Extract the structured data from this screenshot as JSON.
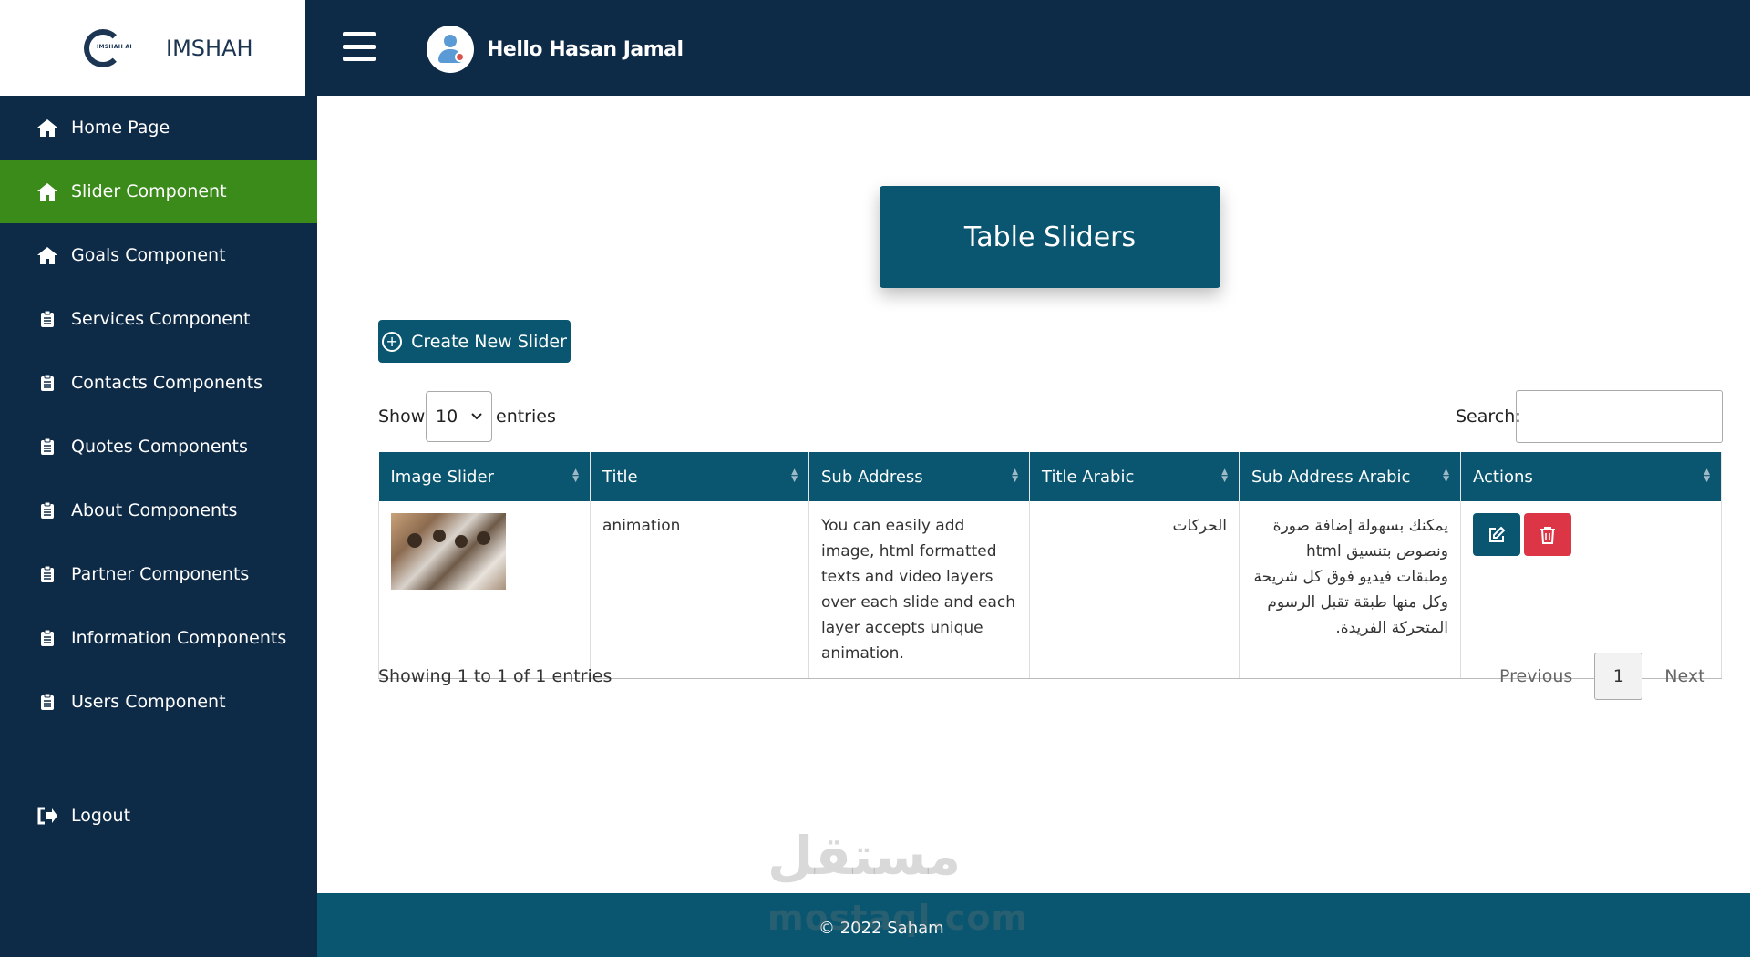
{
  "header": {
    "brand_name": "IMSHAH",
    "brand_logo_text": "IMSHAH AI",
    "greeting": "Hello Hasan Jamal"
  },
  "sidebar": {
    "items": [
      {
        "label": "Home Page",
        "icon": "home-icon",
        "active": false
      },
      {
        "label": "Slider Component",
        "icon": "home-icon",
        "active": true
      },
      {
        "label": "Goals Component",
        "icon": "home-icon",
        "active": false
      },
      {
        "label": "Services Component",
        "icon": "clipboard-icon",
        "active": false
      },
      {
        "label": "Contacts Components",
        "icon": "clipboard-icon",
        "active": false
      },
      {
        "label": "Quotes Components",
        "icon": "clipboard-icon",
        "active": false
      },
      {
        "label": "About Components",
        "icon": "clipboard-icon",
        "active": false
      },
      {
        "label": "Partner Components",
        "icon": "clipboard-icon",
        "active": false
      },
      {
        "label": "Information Components",
        "icon": "clipboard-icon",
        "active": false
      },
      {
        "label": "Users Component",
        "icon": "clipboard-icon",
        "active": false
      }
    ],
    "logout_label": "Logout",
    "active_color": "#3a8b1a"
  },
  "main": {
    "title": "Table Sliders",
    "create_button": "Create New Slider",
    "show_label": "Show",
    "entries_value": "10",
    "entries_label": "entries",
    "search_label": "Search:",
    "table": {
      "headers": [
        "Image Slider",
        "Title",
        "Sub Address",
        "Title Arabic",
        "Sub Address Arabic",
        "Actions"
      ],
      "rows": [
        {
          "title": "animation",
          "sub_address": "You can easily add image, html formatted texts and video layers over each slide and each layer accepts unique animation.",
          "title_arabic": "الحركات",
          "sub_address_arabic": "يمكنك بسهولة إضافة صورة ونصوص بتنسيق html وطبقات فيديو فوق كل شريحة وكل منها طبقة تقبل الرسوم المتحركة الفريدة."
        }
      ]
    },
    "info": "Showing 1 to 1 of 1 entries",
    "pagination": {
      "previous": "Previous",
      "page": "1",
      "next": "Next"
    }
  },
  "footer": {
    "text": "© 2022 Saham"
  },
  "watermark": {
    "arabic": "مستقل",
    "latin": "mostaql.com"
  },
  "colors": {
    "navy": "#0d2a47",
    "teal": "#0a5670",
    "danger": "#dc3545"
  }
}
